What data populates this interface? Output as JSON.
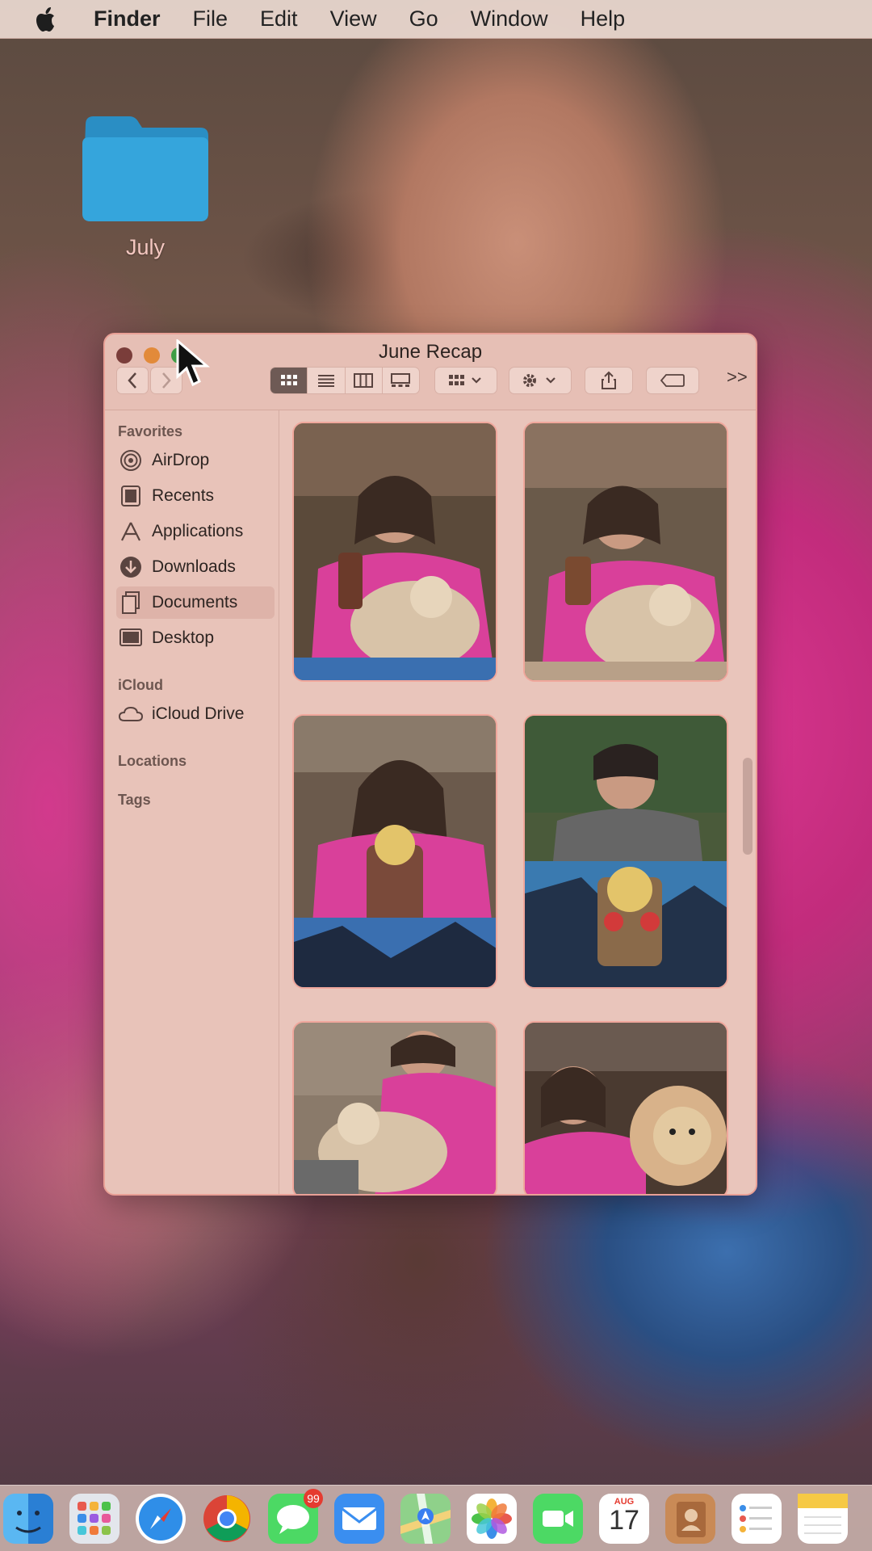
{
  "menubar": {
    "app_name": "Finder",
    "items": [
      "File",
      "Edit",
      "View",
      "Go",
      "Window",
      "Help"
    ]
  },
  "desktop": {
    "folder_label": "July",
    "folder_color": "#2f9bd3"
  },
  "window": {
    "title": "June Recap",
    "sidebar": {
      "favorites_heading": "Favorites",
      "favorites": [
        {
          "label": "AirDrop",
          "icon": "airdrop-icon"
        },
        {
          "label": "Recents",
          "icon": "recents-icon"
        },
        {
          "label": "Applications",
          "icon": "applications-icon"
        },
        {
          "label": "Downloads",
          "icon": "downloads-icon"
        },
        {
          "label": "Documents",
          "icon": "documents-icon"
        },
        {
          "label": "Desktop",
          "icon": "desktop-icon"
        }
      ],
      "icloud_heading": "iCloud",
      "icloud_items": [
        {
          "label": "iCloud Drive",
          "icon": "icloud-icon"
        }
      ],
      "locations_heading": "Locations",
      "tags_heading": "Tags"
    },
    "toolbar": {
      "more_label": ">>"
    },
    "photos": [
      {
        "name": "photo-1",
        "colors": [
          "#5b4a3a",
          "#d9409a",
          "#d8c3a8",
          "#3a6fb0"
        ]
      },
      {
        "name": "photo-2",
        "colors": [
          "#6a5a4a",
          "#d9409a",
          "#d8c3a8",
          "#b8a088"
        ]
      },
      {
        "name": "photo-3",
        "colors": [
          "#6b5a4c",
          "#d9409a",
          "#7a4a3a",
          "#3a6fb0"
        ]
      },
      {
        "name": "photo-4",
        "colors": [
          "#4a5a3a",
          "#666666",
          "#8a6a4a",
          "#3a7ab0"
        ]
      },
      {
        "name": "photo-5",
        "colors": [
          "#8a7a6a",
          "#d9409a",
          "#d8c3a8",
          "#6a6a6a"
        ]
      },
      {
        "name": "photo-6",
        "colors": [
          "#4a3a30",
          "#d9409a",
          "#d8b28a",
          "#6a5a50"
        ]
      }
    ]
  },
  "dock": {
    "apps": [
      "Finder",
      "Launchpad",
      "Safari",
      "Chrome",
      "Messages",
      "Mail",
      "Maps",
      "Photos",
      "FaceTime",
      "Calendar",
      "Contacts",
      "Reminders",
      "Notes"
    ],
    "messages_badge": "99",
    "calendar_month": "AUG",
    "calendar_day": "17"
  }
}
